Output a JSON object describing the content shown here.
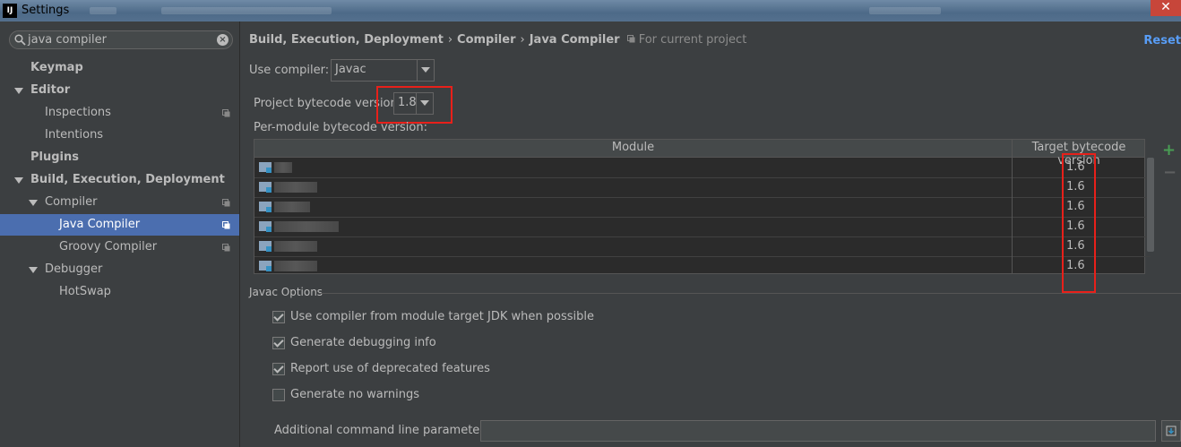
{
  "window": {
    "title": "Settings",
    "logo_text": "IJ"
  },
  "search": {
    "value": "java compiler"
  },
  "tree": [
    {
      "label": "Keymap",
      "bold": true
    },
    {
      "label": "Editor",
      "bold": true
    },
    {
      "label": "Inspections"
    },
    {
      "label": "Intentions"
    },
    {
      "label": "Plugins",
      "bold": true
    },
    {
      "label": "Build, Execution, Deployment",
      "bold": true
    },
    {
      "label": "Compiler"
    },
    {
      "label": "Java Compiler",
      "selected": true
    },
    {
      "label": "Groovy Compiler"
    },
    {
      "label": "Debugger"
    },
    {
      "label": "HotSwap"
    }
  ],
  "breadcrumb": {
    "part1": "Build, Execution, Deployment",
    "part2": "Compiler",
    "part3": "Java Compiler",
    "sep": "›",
    "scope": "For current project"
  },
  "reset_label": "Reset",
  "use_compiler": {
    "label": "Use compiler:",
    "value": "Javac"
  },
  "project_bytecode": {
    "label": "Project bytecode version:",
    "value": "1.8"
  },
  "per_module": {
    "label": "Per-module bytecode version:",
    "columns": [
      "Module",
      "Target bytecode version"
    ],
    "rows": [
      {
        "target": "1.6"
      },
      {
        "target": "1.6"
      },
      {
        "target": "1.6"
      },
      {
        "target": "1.6"
      },
      {
        "target": "1.6"
      },
      {
        "target": "1.6"
      }
    ],
    "add_icon": "+",
    "remove_icon": "−"
  },
  "javac_options": {
    "section": "Javac Options",
    "checkboxes": [
      {
        "label": "Use compiler from module target JDK when possible",
        "checked": true
      },
      {
        "label": "Generate debugging info",
        "checked": true
      },
      {
        "label": "Report use of deprecated features",
        "checked": true
      },
      {
        "label": "Generate no warnings",
        "checked": false
      }
    ],
    "additional_label": "Additional command line parameters:",
    "additional_value": ""
  },
  "colors": {
    "accent": "#4b6eaf",
    "link": "#589df6",
    "highlight": "#e8201a",
    "add": "#499c54"
  }
}
